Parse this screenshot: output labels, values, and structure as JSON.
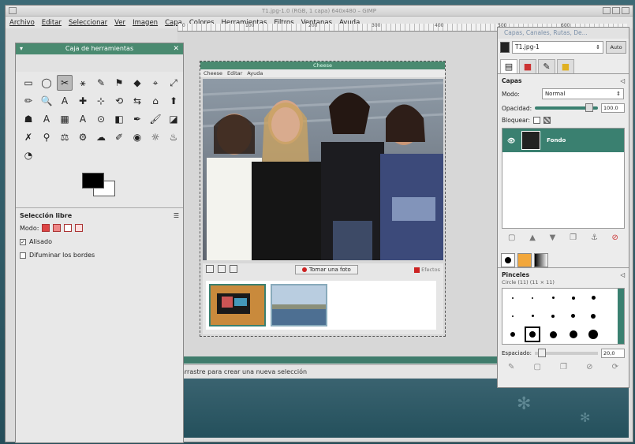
{
  "window": {
    "title": "T1.jpg-1.0 (RGB, 1 capa) 640x480 – GIMP"
  },
  "menu": [
    "Archivo",
    "Editar",
    "Seleccionar",
    "Ver",
    "Imagen",
    "Capa",
    "Colores",
    "Herramientas",
    "Filtros",
    "Ventanas",
    "Ayuda"
  ],
  "ruler": [
    "0",
    "100",
    "200",
    "300",
    "400",
    "500",
    "600"
  ],
  "toolbox": {
    "title": "Caja de herramientas",
    "options_title": "Selección libre",
    "mode_label": "Modo:",
    "antialias_label": "Alisado",
    "feather_label": "Difuminar los bordes",
    "tools": [
      "▭",
      "◯",
      "✂",
      "⚹",
      "✎",
      "⚑",
      "◆",
      "⌖",
      "⤢",
      "✏",
      "🔍",
      "A",
      "✚",
      "⊹",
      "⟲",
      "⇆",
      "⌂",
      "⬆",
      "☗",
      "A",
      "▦",
      "A",
      "⊙",
      "◧",
      "✒",
      "🖌",
      "◪",
      "✗",
      "⚲",
      "⚖",
      "⚙",
      "☁",
      "✐",
      "◉",
      "☼",
      "♨",
      "◔"
    ]
  },
  "image_window": {
    "title": "Cheese",
    "menu": [
      "Cheese",
      "Editar",
      "Ayuda"
    ],
    "take_photo": "Tomar una foto",
    "effects": "Efectos"
  },
  "statusbar": {
    "text": "arrastre para crear una nueva selección"
  },
  "dock": {
    "title": "Capas, Canales, Rutas, De...",
    "image_name": "T1.jpg-1",
    "auto_label": "Auto",
    "layers_title": "Capas",
    "mode_label": "Modo:",
    "mode_value": "Normal",
    "opacity_label": "Opacidad:",
    "opacity_value": "100.0",
    "lock_label": "Bloquear:",
    "layer_name": "Fondo",
    "brushes_title": "Pinceles",
    "brush_name": "Circle (11) (11 × 11)",
    "spacing_label": "Espaciado:",
    "spacing_value": "20,0"
  }
}
